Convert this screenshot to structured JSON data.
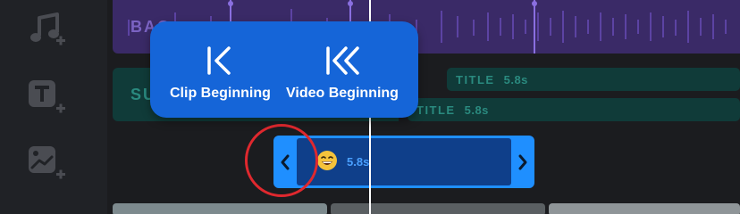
{
  "tools": [
    {
      "name": "add-music",
      "icon": "music-note-plus-icon"
    },
    {
      "name": "add-text",
      "icon": "text-t-plus-icon"
    },
    {
      "name": "add-sticker",
      "icon": "sticker-plus-icon"
    }
  ],
  "tracks": {
    "audio_label": "BAC",
    "subtitle_label": "SU",
    "titles": [
      {
        "label": "TITLE",
        "duration": "5.8s"
      },
      {
        "label": "TITLE",
        "duration": "5.8s"
      }
    ],
    "sticker": {
      "emoji": "grinning-face",
      "duration": "5.8s"
    }
  },
  "popup": {
    "clip_beginning": "Clip Beginning",
    "video_beginning": "Video Beginning"
  },
  "colors": {
    "popup_bg": "#1565d8",
    "sticker_clip": "#1f8fff",
    "audio_track": "#3a2a67",
    "title_track": "#103b39",
    "highlight": "#e0282e"
  }
}
